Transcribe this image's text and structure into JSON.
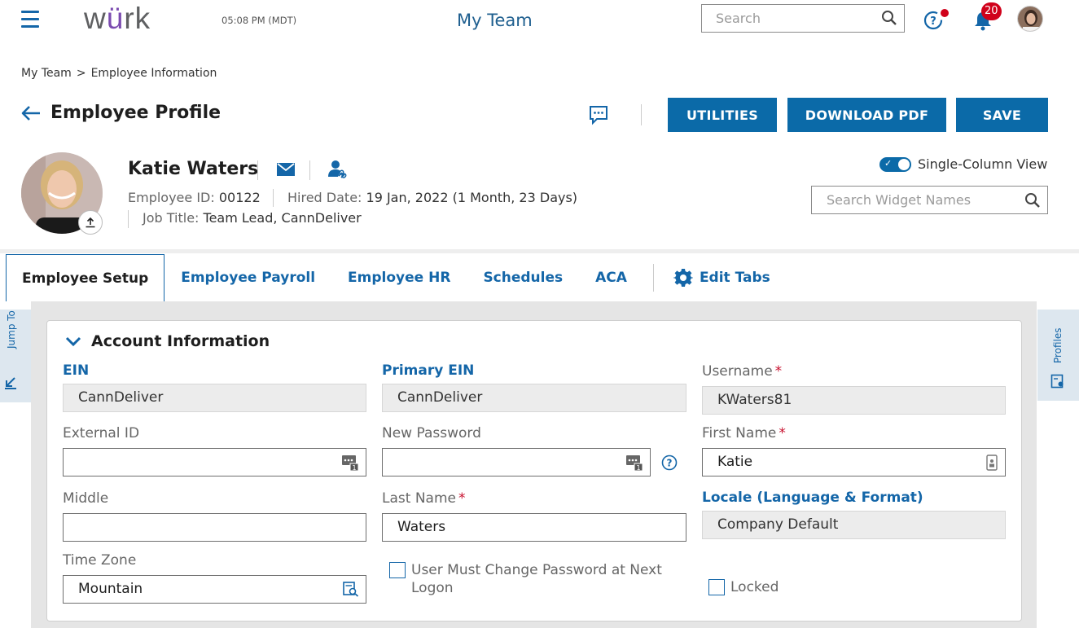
{
  "header": {
    "logo_pre": "w",
    "logo_u": "ü",
    "logo_post": "rk",
    "time": "05:08 PM (MDT)",
    "title": "My Team",
    "search_placeholder": "Search",
    "notification_count": "20"
  },
  "breadcrumb": {
    "items": [
      "My Team",
      "Employee Information"
    ],
    "separator": ">"
  },
  "page": {
    "title": "Employee Profile",
    "buttons": {
      "utilities": "UTILITIES",
      "download": "DOWNLOAD PDF",
      "save": "SAVE"
    }
  },
  "profile": {
    "name": "Katie Waters",
    "employee_id_label": "Employee ID:",
    "employee_id": "00122",
    "hired_label": "Hired Date:",
    "hired": "19 Jan, 2022 (1 Month, 23 Days)",
    "job_title_label": "Job Title:",
    "job_title": "Team Lead, CannDeliver",
    "single_column_label": "Single-Column View",
    "single_column_on": true,
    "widget_search_placeholder": "Search Widget Names"
  },
  "tabs": [
    {
      "label": "Employee Setup",
      "active": true
    },
    {
      "label": "Employee Payroll",
      "active": false
    },
    {
      "label": "Employee HR",
      "active": false
    },
    {
      "label": "Schedules",
      "active": false
    },
    {
      "label": "ACA",
      "active": false
    }
  ],
  "edit_tabs_label": "Edit Tabs",
  "rails": {
    "left": "Jump To",
    "right": "Profiles"
  },
  "account": {
    "title": "Account Information",
    "ein_label": "EIN",
    "ein": "CannDeliver",
    "primary_ein_label": "Primary EIN",
    "primary_ein": "CannDeliver",
    "username_label": "Username",
    "username": "KWaters81",
    "external_id_label": "External ID",
    "external_id": "",
    "new_password_label": "New Password",
    "new_password": "",
    "first_name_label": "First Name",
    "first_name": "Katie",
    "middle_label": "Middle",
    "middle": "",
    "last_name_label": "Last Name",
    "last_name": "Waters",
    "locale_label": "Locale (Language & Format)",
    "locale": "Company Default",
    "time_zone_label": "Time Zone",
    "time_zone": "Mountain",
    "must_change_line1": "User Must Change Password at Next",
    "must_change_line2": "Logon",
    "locked_label": "Locked",
    "required_mark": "*"
  },
  "colors": {
    "primary": "#0b6aa8",
    "link": "#1466a8",
    "alert": "#d0021b",
    "required": "#c8102e"
  }
}
